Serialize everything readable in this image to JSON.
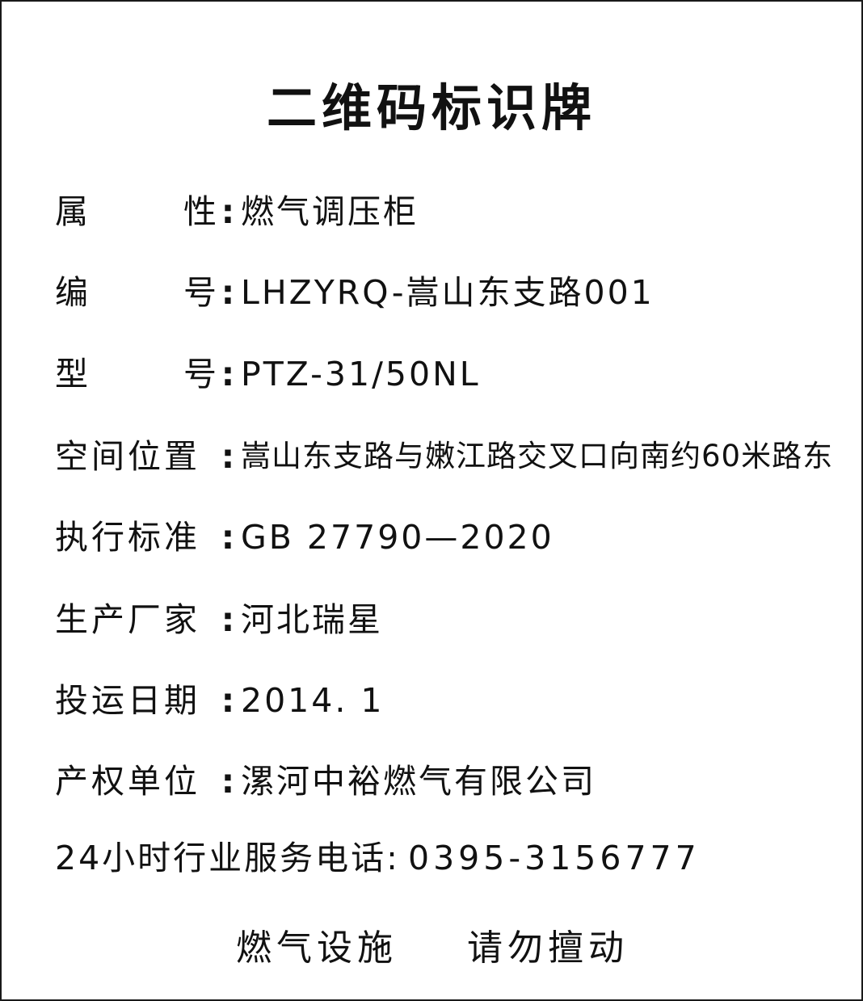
{
  "title": "二维码标识牌",
  "fields": {
    "attribute": {
      "label_1": "属",
      "label_2": "性",
      "colon": ":",
      "value": "燃气调压柜"
    },
    "serial": {
      "label_1": "编",
      "label_2": "号",
      "colon": ":",
      "value": "LHZYRQ-嵩山东支路001"
    },
    "model": {
      "label_1": "型",
      "label_2": "号",
      "colon": ":",
      "value": "PTZ-31/50NL"
    },
    "location": {
      "label": "空间位置",
      "colon": ":",
      "value": "嵩山东支路与嫩江路交叉口向南约60米路东"
    },
    "standard": {
      "label": "执行标准",
      "colon": ":",
      "value": "GB 27790—2020"
    },
    "manufacturer": {
      "label": "生产厂家",
      "colon": ":",
      "value": "河北瑞星"
    },
    "commission_date": {
      "label": "投运日期",
      "colon": ":",
      "value": "2014. 1"
    },
    "owner": {
      "label": "产权单位",
      "colon": ":",
      "value": "漯河中裕燃气有限公司"
    }
  },
  "hotline": {
    "label": "24小时行业服务电话:",
    "number": "0395-3156777"
  },
  "warning": {
    "part_1": "燃气设施",
    "part_2": "请勿擅动"
  }
}
